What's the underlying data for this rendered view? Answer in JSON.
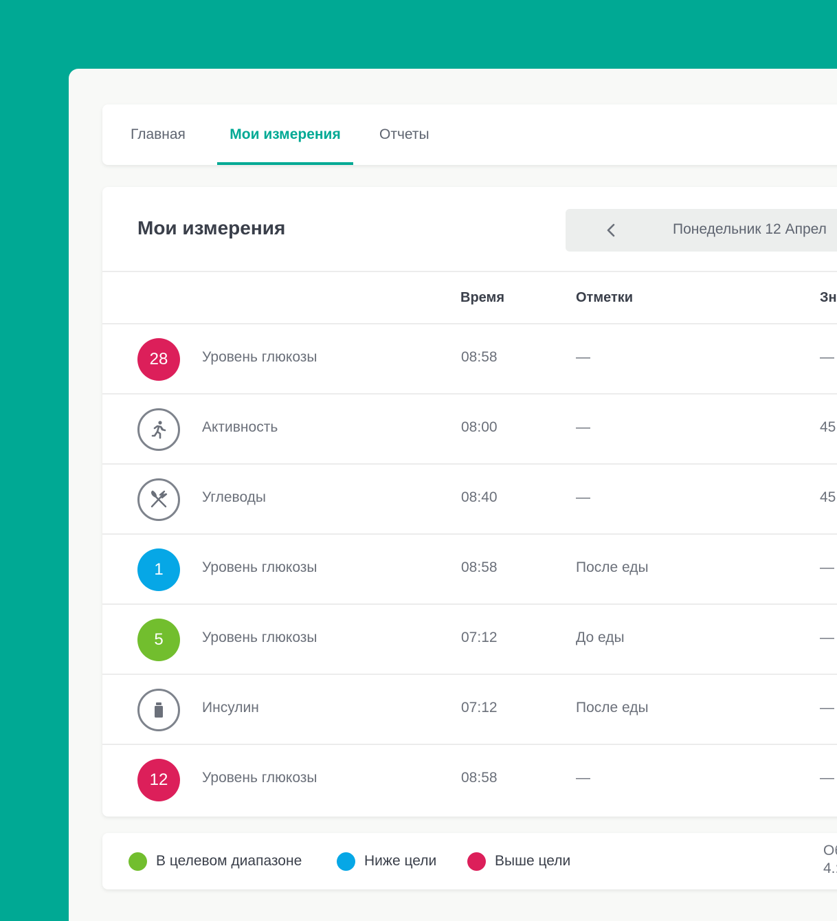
{
  "nav": {
    "tabs": [
      {
        "label": "Главная",
        "active": false
      },
      {
        "label": "Мои измерения",
        "active": true
      },
      {
        "label": "Отчеты",
        "active": false
      }
    ]
  },
  "header": {
    "title": "Мои измерения",
    "date_label": "Понедельник 12 Апрел",
    "prev_icon": "chevron-left-icon"
  },
  "table": {
    "columns": [
      "Время",
      "Отметки",
      "Зн"
    ],
    "rows": [
      {
        "badge": "28",
        "badge_color": "#dc1f5a",
        "icon": null,
        "name": "Уровень глюкозы",
        "time": "08:58",
        "note": "—",
        "value": "—"
      },
      {
        "badge": "",
        "badge_color": null,
        "icon": "running-person-icon",
        "name": "Активность",
        "time": "08:00",
        "note": "—",
        "value": "45"
      },
      {
        "badge": "",
        "badge_color": null,
        "icon": "fork-knife-icon",
        "name": "Углеводы",
        "time": "08:40",
        "note": "—",
        "value": "45"
      },
      {
        "badge": "1",
        "badge_color": "#06a7e6",
        "icon": null,
        "name": "Уровень глюкозы",
        "time": "08:58",
        "note": "После еды",
        "value": "—"
      },
      {
        "badge": "5",
        "badge_color": "#72be2e",
        "icon": null,
        "name": "Уровень глюкозы",
        "time": "07:12",
        "note": "До еды",
        "value": "—"
      },
      {
        "badge": "",
        "badge_color": null,
        "icon": "insulin-bottle-icon",
        "name": "Инсулин",
        "time": "07:12",
        "note": "После еды",
        "value": "—"
      },
      {
        "badge": "12",
        "badge_color": "#dc1f5a",
        "icon": null,
        "name": "Уровень глюкозы",
        "time": "08:58",
        "note": "—",
        "value": "—"
      }
    ]
  },
  "legend": {
    "items": [
      {
        "label": "В целевом диапазоне",
        "color": "#72be2e"
      },
      {
        "label": "Ниже цели",
        "color": "#06a7e6"
      },
      {
        "label": "Выше цели",
        "color": "#dc1f5a"
      }
    ],
    "trailing_line1": "Об",
    "trailing_line2": "4.:"
  },
  "colors": {
    "accent": "#00a994",
    "high": "#dc1f5a",
    "low": "#06a7e6",
    "in_range": "#72be2e"
  }
}
